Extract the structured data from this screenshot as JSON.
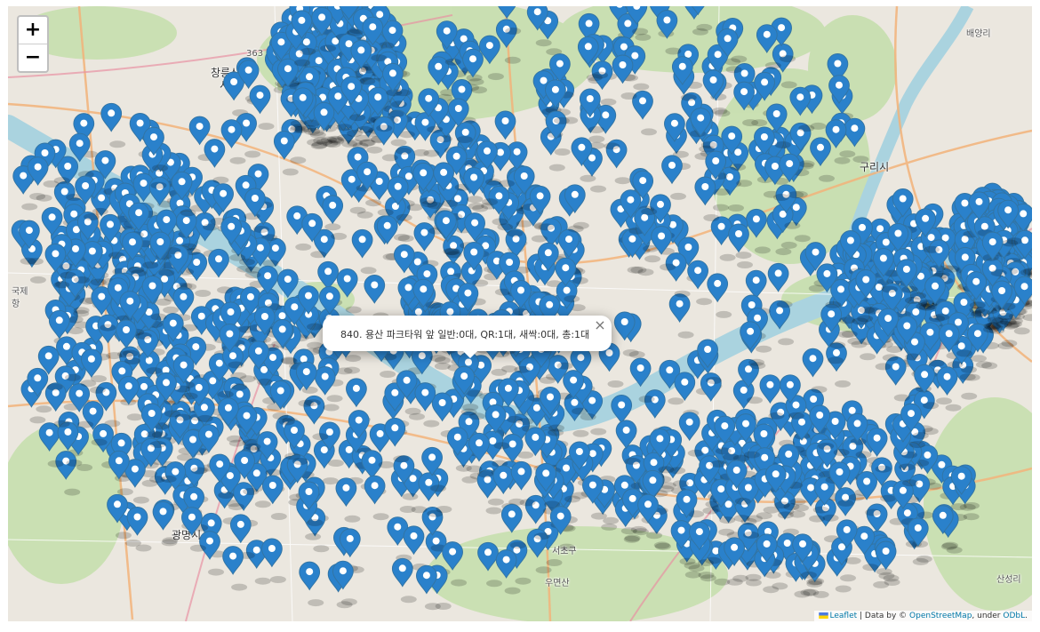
{
  "zoom": {
    "in_label": "+",
    "out_label": "−"
  },
  "labels": [
    {
      "text": "창릉신도",
      "cls": ""
    },
    {
      "text": "시",
      "cls": ""
    },
    {
      "text": "구리시",
      "cls": ""
    },
    {
      "text": "광명시",
      "cls": ""
    },
    {
      "text": "배양리",
      "cls": "small"
    },
    {
      "text": "산성리",
      "cls": "small"
    },
    {
      "text": "서초구",
      "cls": "small"
    },
    {
      "text": "우면산",
      "cls": "small"
    },
    {
      "text": "국제",
      "cls": "small"
    },
    {
      "text": "항",
      "cls": "small"
    },
    {
      "text": "363",
      "cls": "small"
    }
  ],
  "popup": {
    "text": "840. 용산 파크타워 앞 일반:0대, QR:1대, 새싹:0대, 총:1대",
    "close_label": "×"
  },
  "attribution": {
    "leaflet": "Leaflet",
    "sep": " | Data by © ",
    "osm": "OpenStreetMap",
    "under": ", under ",
    "odbl": "ODbL",
    "end": "."
  },
  "colors": {
    "marker": "#2A81CB",
    "marker_dark": "#3274A3",
    "river": "#aad3df",
    "park": "#c8e0b4",
    "urban": "#e8e3dc"
  }
}
